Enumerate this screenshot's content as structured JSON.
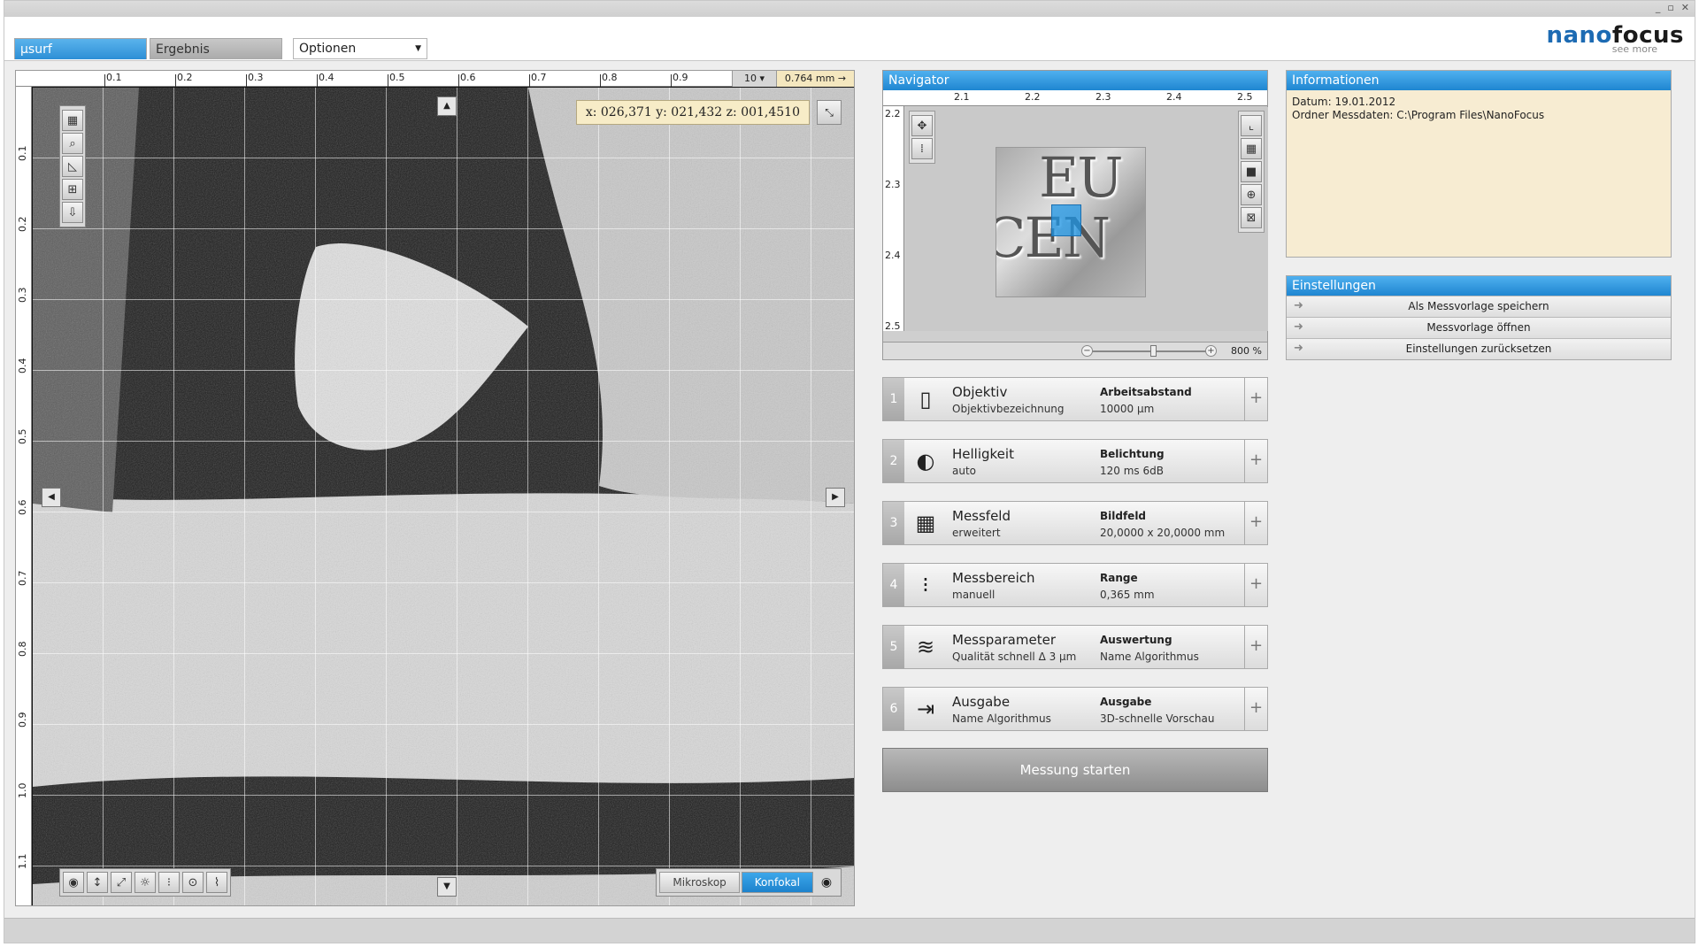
{
  "tabs": [
    {
      "label": "µsurf",
      "active": true
    },
    {
      "label": "Ergebnis",
      "active": false
    }
  ],
  "options_select": {
    "value": "Optionen"
  },
  "logo": {
    "main_a": "nano",
    "main_b": "focus",
    "tagline": "see more"
  },
  "window_controls": {
    "minimize": "_",
    "maximize": "▫",
    "close": "✕"
  },
  "viewer": {
    "ruler_x": [
      "0.1",
      "0.2",
      "0.3",
      "0.4",
      "0.5",
      "0.6",
      "0.7",
      "0.8",
      "0.9"
    ],
    "ruler_y": [
      "0.1",
      "0.2",
      "0.3",
      "0.4",
      "0.5",
      "0.6",
      "0.7",
      "0.8",
      "0.9",
      "1.0",
      "1.1"
    ],
    "zoom_select": "10 ▾",
    "scale_mm": "0.764 mm →",
    "coords": "x: 026,371  y: 021,432  z: 001,4510",
    "modes": [
      {
        "label": "Mikroskop",
        "active": false
      },
      {
        "label": "Konfokal",
        "active": true
      }
    ]
  },
  "navigator": {
    "title": "Navigator",
    "ruler_x": [
      "2.1",
      "2.2",
      "2.3",
      "2.4",
      "2.5"
    ],
    "ruler_y": [
      "2.2",
      "2.3",
      "2.4",
      "2.5"
    ],
    "zoom": "800 %",
    "thumb_text_1": "EU",
    "thumb_text_2": "CEN"
  },
  "steps": [
    {
      "num": "1",
      "icon": "objective-icon",
      "title": "Objektiv",
      "sub": "Objektivbezeichnung",
      "param_title": "Arbeitsabstand",
      "param_value": "10000 µm"
    },
    {
      "num": "2",
      "icon": "brightness-icon",
      "title": "Helligkeit",
      "sub": "auto",
      "param_title": "Belichtung",
      "param_value": "120 ms   6dB"
    },
    {
      "num": "3",
      "icon": "grid-icon",
      "title": "Messfeld",
      "sub": "erweitert",
      "param_title": "Bildfeld",
      "param_value": "20,0000 x 20,0000 mm"
    },
    {
      "num": "4",
      "icon": "range-icon",
      "title": "Messbereich",
      "sub": "manuell",
      "param_title": "Range",
      "param_value": "0,365 mm"
    },
    {
      "num": "5",
      "icon": "layers-icon",
      "title": "Messparameter",
      "sub": "Qualität schnell   Δ 3 µm",
      "param_title": "Auswertung",
      "param_value": "Name Algorithmus"
    },
    {
      "num": "6",
      "icon": "export-icon",
      "title": "Ausgabe",
      "sub": "Name Algorithmus",
      "param_title": "Ausgabe",
      "param_value": "3D-schnelle Vorschau"
    }
  ],
  "start_button": "Messung starten",
  "info": {
    "title": "Informationen",
    "line1": "Datum: 19.01.2012",
    "line2": "Ordner Messdaten: C:\\Program Files\\NanoFocus"
  },
  "settings": {
    "title": "Einstellungen",
    "items": [
      "Als Messvorlage speichern",
      "Messvorlage öffnen",
      "Einstellungen zurücksetzen"
    ]
  }
}
